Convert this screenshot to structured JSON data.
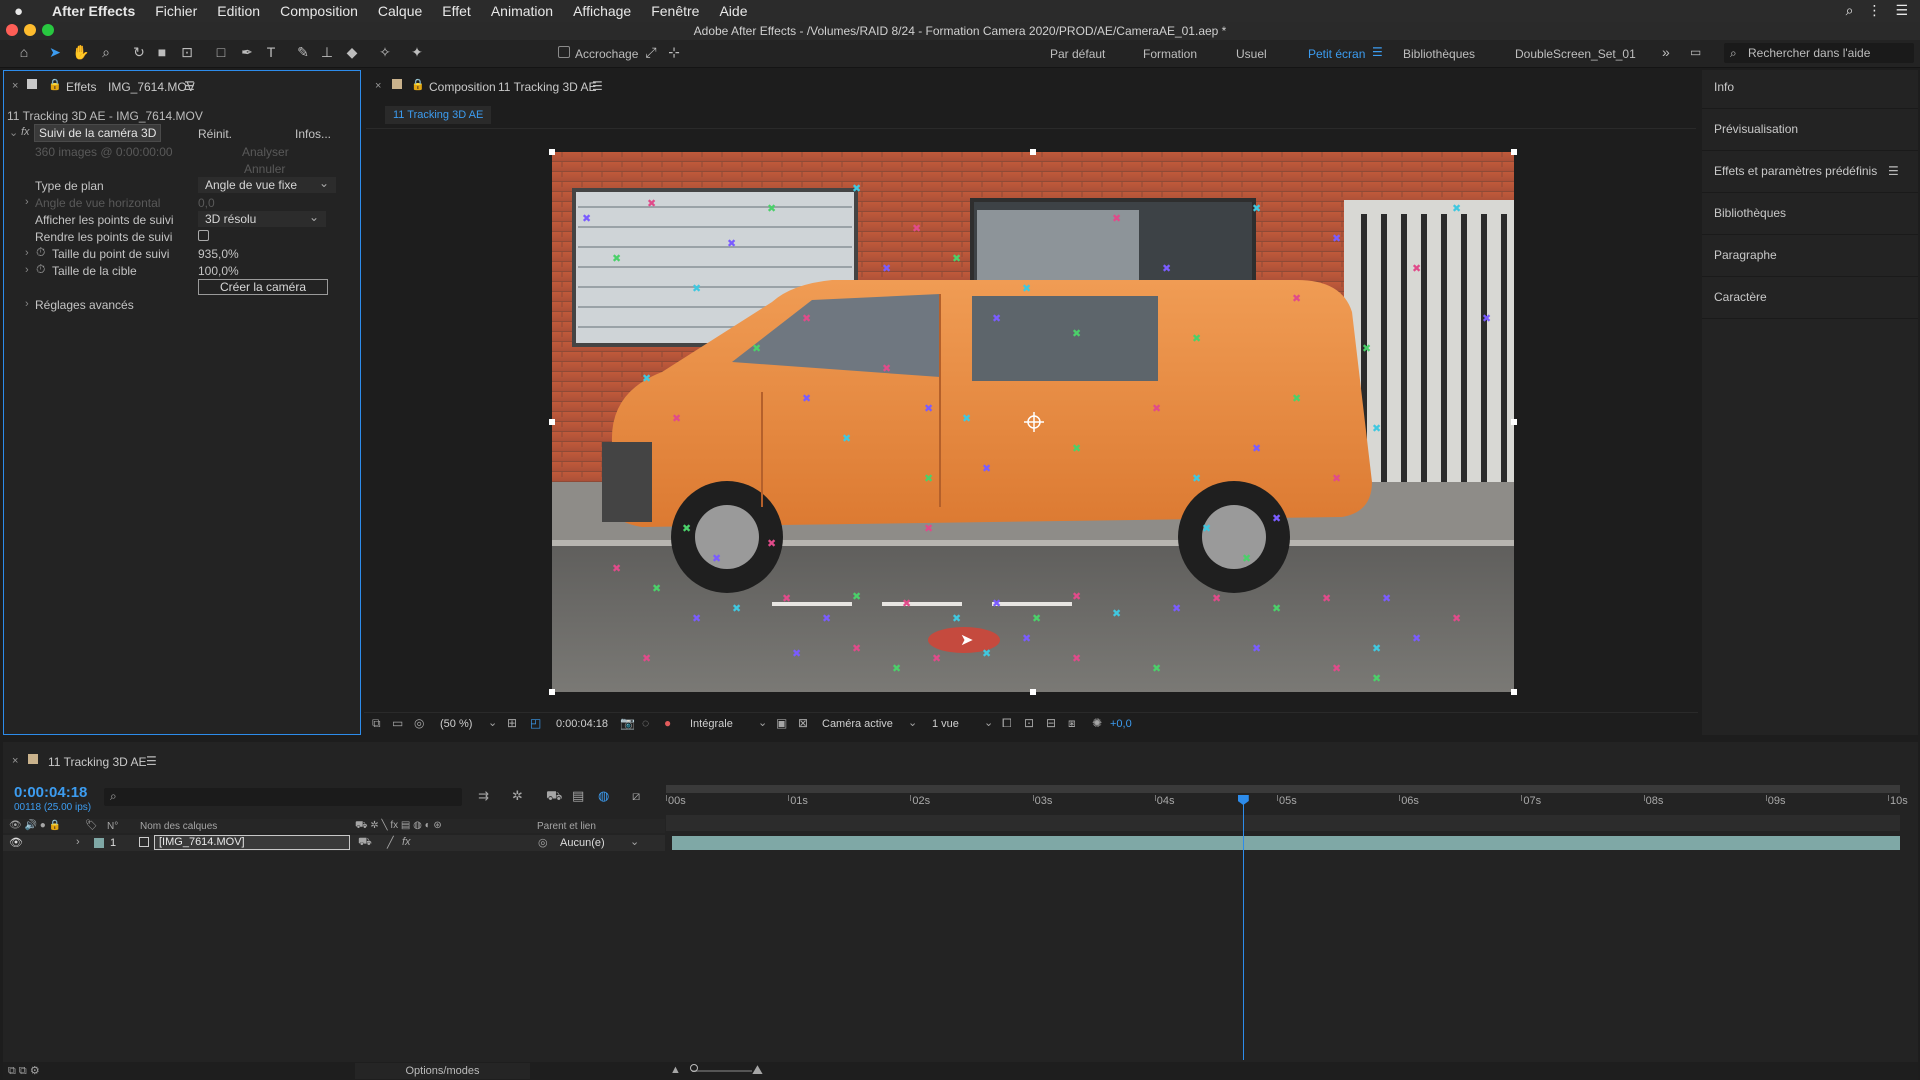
{
  "menubar": {
    "app": "After Effects",
    "items": [
      "Fichier",
      "Edition",
      "Composition",
      "Calque",
      "Effet",
      "Animation",
      "Affichage",
      "Fenêtre",
      "Aide"
    ]
  },
  "window_title": "Adobe After Effects - /Volumes/RAID 8/24 - Formation Camera 2020/PROD/AE/CameraAE_01.aep *",
  "toolbar": {
    "snap_label": "Accrochage",
    "workspaces": [
      "Par défaut",
      "Formation",
      "Usuel",
      "Petit écran",
      "Bibliothèques",
      "DoubleScreen_Set_01"
    ],
    "active_workspace": "Petit écran",
    "search_placeholder": "Rechercher dans l'aide"
  },
  "effects_panel": {
    "tab_prefix": "Effets",
    "tab_layer": "IMG_7614.MOV",
    "breadcrumb": "11 Tracking 3D AE - IMG_7614.MOV",
    "effect_name": "Suivi de la caméra 3D",
    "reset": "Réinit.",
    "infos": "Infos...",
    "frames_info": "360 images @ 0:00:00:00",
    "analyze": "Analyser",
    "cancel": "Annuler",
    "plan_type_label": "Type de plan",
    "plan_type_value": "Angle de vue fixe",
    "hfov_label": "Angle de vue horizontal",
    "hfov_value": "0,0",
    "show_points_label": "Afficher les points de suivi",
    "show_points_value": "3D résolu",
    "render_points_label": "Rendre les points de suivi",
    "point_size_label": "Taille du point de suivi",
    "point_size_value": "935,0%",
    "target_size_label": "Taille de la cible",
    "target_size_value": "100,0%",
    "create_camera": "Créer la caméra",
    "advanced": "Réglages avancés"
  },
  "comp_panel": {
    "tab_prefix": "Composition",
    "tab_comp": "11 Tracking 3D AE",
    "subtab": "11 Tracking 3D AE",
    "zoom": "(50 %)",
    "timecode": "0:00:04:18",
    "resolution": "Intégrale",
    "camera": "Caméra active",
    "views": "1 vue",
    "exposure": "+0,0"
  },
  "right_panels": [
    "Info",
    "Prévisualisation",
    "Effets et paramètres prédéfinis",
    "Bibliothèques",
    "Paragraphe",
    "Caractère"
  ],
  "timeline": {
    "tab": "11 Tracking 3D AE",
    "timecode": "0:00:04:18",
    "frame_info": "00118 (25.00 ips)",
    "col_num": "N°",
    "col_name": "Nom des calques",
    "col_parent": "Parent et lien",
    "layer_index": "1",
    "layer_name": "[IMG_7614.MOV]",
    "parent_value": "Aucun(e)",
    "ruler": [
      "00s",
      "01s",
      "02s",
      "03s",
      "04s",
      "05s",
      "06s",
      "07s",
      "08s",
      "09s",
      "10s"
    ],
    "playhead_seconds": 4.72,
    "duration_seconds": 10,
    "options_modes": "Options/modes"
  },
  "colors": {
    "accent": "#2d8ceb",
    "layer_bar": "#7fa8a6",
    "van_orange": "#e98a3f"
  }
}
